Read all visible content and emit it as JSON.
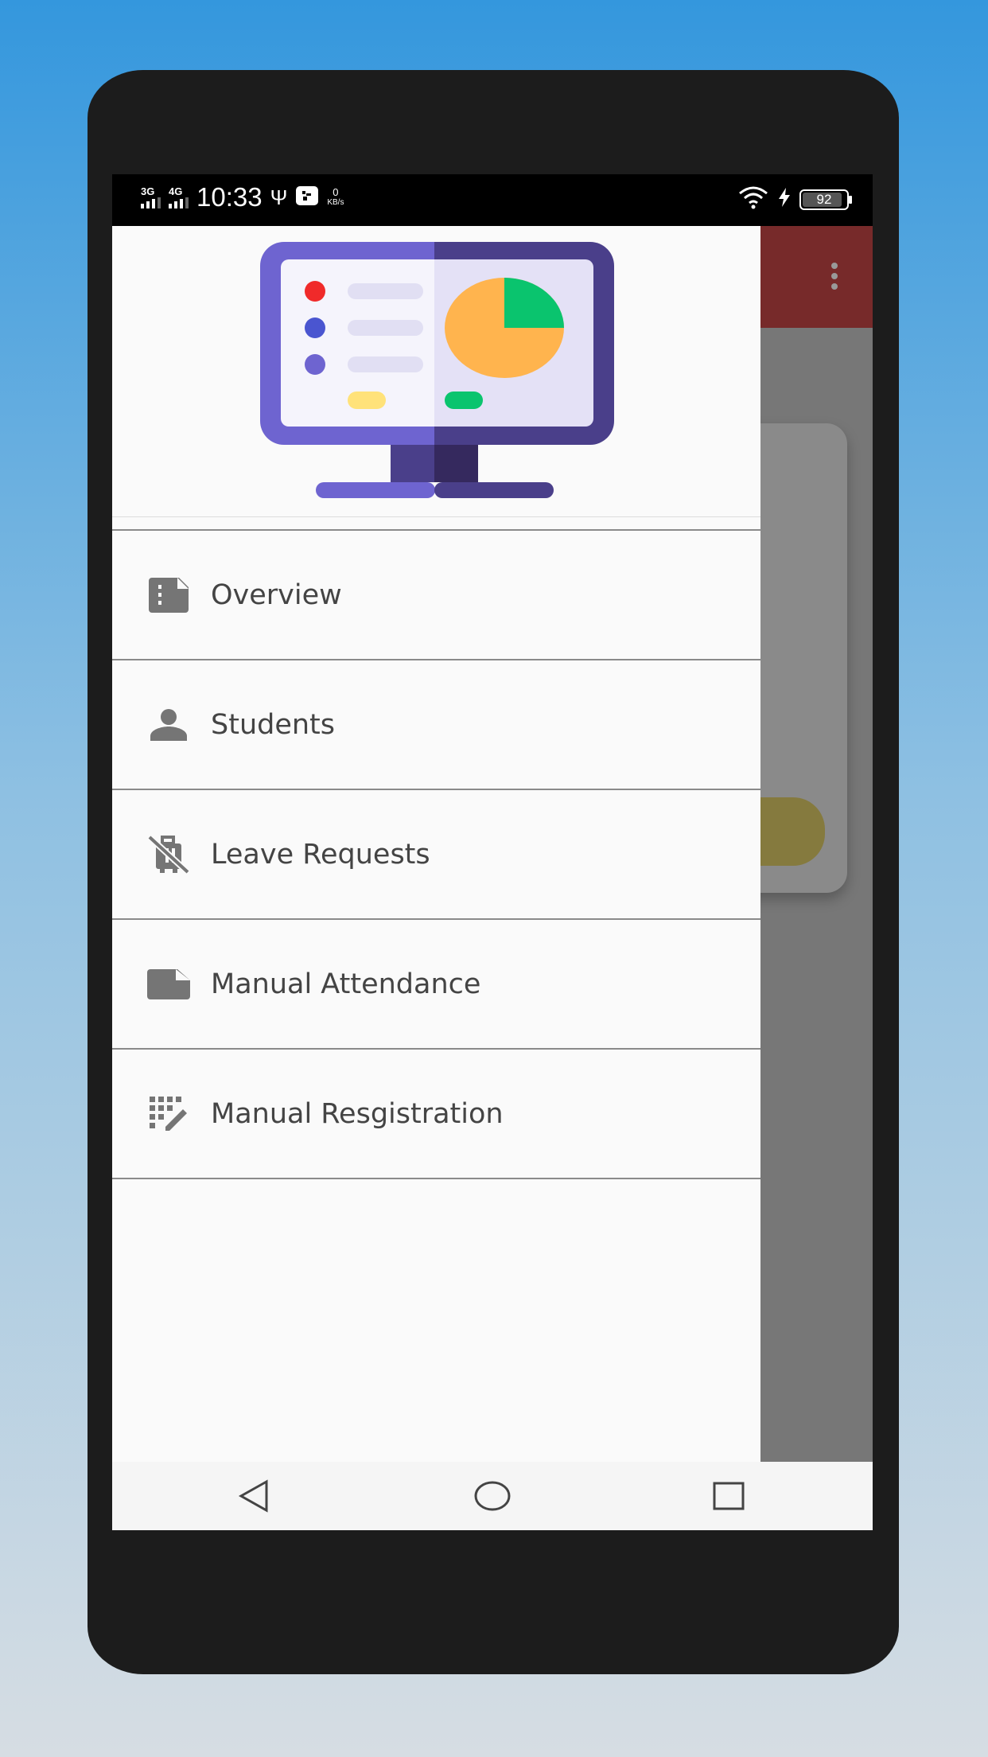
{
  "status_bar": {
    "network_1": "3G",
    "network_2": "4G",
    "time": "10:33",
    "speed_value": "0",
    "speed_unit": "KB/s",
    "battery": "92",
    "battery_level": 0.92,
    "icons": [
      "usb-icon",
      "usb-debug-icon",
      "wifi-icon",
      "charging-icon"
    ]
  },
  "drawer": {
    "header_image": "monitor-dashboard-illustration",
    "items": [
      {
        "label": "Overview",
        "icon": "overview-icon"
      },
      {
        "label": "Students",
        "icon": "person-icon"
      },
      {
        "label": "Leave Requests",
        "icon": "no-luggage-icon"
      },
      {
        "label": "Manual Attendance",
        "icon": "folder-icon"
      },
      {
        "label": "Manual Resgistration",
        "icon": "grid-edit-icon"
      }
    ]
  },
  "background_app": {
    "appbar_color": "#772a2a",
    "overflow_icon": "more-vert-icon"
  },
  "nav_bar": {
    "buttons": [
      "back-icon",
      "home-icon",
      "recents-icon"
    ]
  },
  "colors": {
    "purple": "#6e64d0",
    "dark_purple": "#4a3f8a",
    "orange": "#ffb44e",
    "green": "#0ac46e",
    "red": "#f02a2a"
  }
}
